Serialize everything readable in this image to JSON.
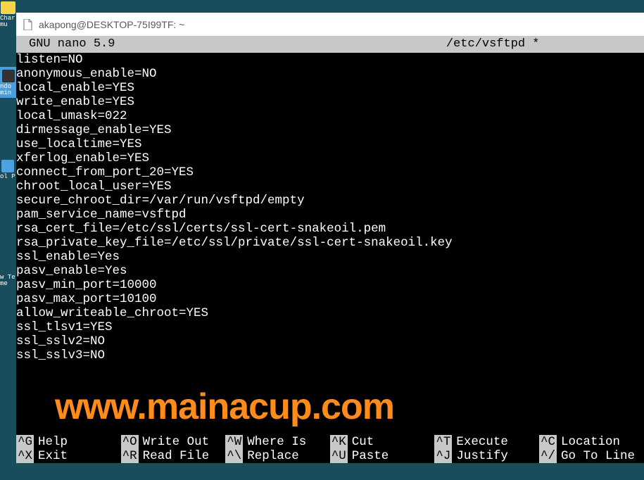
{
  "desktop": {
    "icon1_label": "Char\nmu",
    "icon2_label": "ndo\nmin",
    "icon3_label": "ol P",
    "icon4_label": "w Te\nme"
  },
  "window": {
    "title": "akapong@DESKTOP-75I99TF: ~"
  },
  "nano": {
    "app_title": "GNU nano 5.9",
    "filename": "/etc/vsftpd *"
  },
  "config_lines": [
    "listen=NO",
    "anonymous_enable=NO",
    "local_enable=YES",
    "write_enable=YES",
    "local_umask=022",
    "dirmessage_enable=YES",
    "use_localtime=YES",
    "xferlog_enable=YES",
    "connect_from_port_20=YES",
    "chroot_local_user=YES",
    "secure_chroot_dir=/var/run/vsftpd/empty",
    "pam_service_name=vsftpd",
    "rsa_cert_file=/etc/ssl/certs/ssl-cert-snakeoil.pem",
    "rsa_private_key_file=/etc/ssl/private/ssl-cert-snakeoil.key",
    "ssl_enable=Yes",
    "pasv_enable=Yes",
    "pasv_min_port=10000",
    "pasv_max_port=10100",
    "allow_writeable_chroot=YES",
    "ssl_tlsv1=YES",
    "ssl_sslv2=NO",
    "ssl_sslv3=NO"
  ],
  "watermark": "www.mainacup.com",
  "shortcuts": {
    "row1": [
      {
        "key": "^G",
        "label": "Help"
      },
      {
        "key": "^O",
        "label": "Write Out"
      },
      {
        "key": "^W",
        "label": "Where Is"
      },
      {
        "key": "^K",
        "label": "Cut"
      },
      {
        "key": "^T",
        "label": "Execute"
      },
      {
        "key": "^C",
        "label": "Location"
      }
    ],
    "row2": [
      {
        "key": "^X",
        "label": "Exit"
      },
      {
        "key": "^R",
        "label": "Read File"
      },
      {
        "key": "^\\",
        "label": "Replace"
      },
      {
        "key": "^U",
        "label": "Paste"
      },
      {
        "key": "^J",
        "label": "Justify"
      },
      {
        "key": "^/",
        "label": "Go To Line"
      }
    ]
  }
}
